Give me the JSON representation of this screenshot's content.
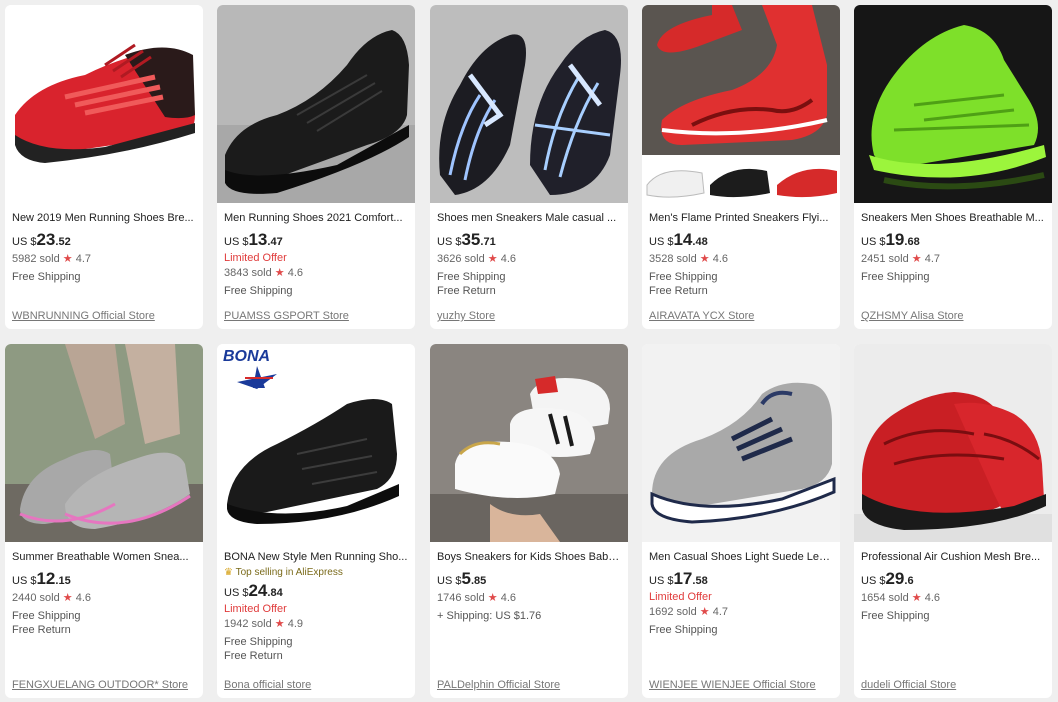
{
  "products": [
    {
      "title": "New 2019 Men Running Shoes Bre...",
      "currency": "US $",
      "price_main": "23",
      "price_cents": ".52",
      "limited": "",
      "top_selling": "",
      "sold": "5982 sold",
      "rating": "4.7",
      "shipping": "Free Shipping",
      "shipping2": "",
      "store": "WBNRUNNING Official Store",
      "image": "red-black running sneaker"
    },
    {
      "title": "Men Running Shoes 2021 Comfort...",
      "currency": "US $",
      "price_main": "13",
      "price_cents": ".47",
      "limited": "Limited Offer",
      "top_selling": "",
      "sold": "3843 sold",
      "rating": "4.6",
      "shipping": "Free Shipping",
      "shipping2": "",
      "store": "PUAMSS GSPORT Store",
      "image": "black knit sneaker"
    },
    {
      "title": "Shoes men Sneakers Male casual ...",
      "currency": "US $",
      "price_main": "35",
      "price_cents": ".71",
      "limited": "",
      "top_selling": "",
      "sold": "3626 sold",
      "rating": "4.6",
      "shipping": "Free Shipping",
      "shipping2": "Free Return",
      "store": "yuzhy Store",
      "image": "black silver blade sneakers"
    },
    {
      "title": "Men's Flame Printed Sneakers Flyi...",
      "currency": "US $",
      "price_main": "14",
      "price_cents": ".48",
      "limited": "",
      "top_selling": "",
      "sold": "3528 sold",
      "rating": "4.6",
      "shipping": "Free Shipping",
      "shipping2": "Free Return",
      "store": "AIRAVATA YCX Store",
      "image": "red flame sneakers"
    },
    {
      "title": "Sneakers Men Shoes Breathable M...",
      "currency": "US $",
      "price_main": "19",
      "price_cents": ".68",
      "limited": "",
      "top_selling": "",
      "sold": "2451 sold",
      "rating": "4.7",
      "shipping": "Free Shipping",
      "shipping2": "",
      "store": "QZHSMY Alisa Store",
      "image": "neon green sneaker"
    },
    {
      "title": "Summer Breathable Women Snea...",
      "currency": "US $",
      "price_main": "12",
      "price_cents": ".15",
      "limited": "",
      "top_selling": "",
      "sold": "2440 sold",
      "rating": "4.6",
      "shipping": "Free Shipping",
      "shipping2": "Free Return",
      "store": "FENGXUELANG OUTDOOR* Store",
      "image": "grey women mesh shoes"
    },
    {
      "title": "BONA New Style Men Running Sho...",
      "currency": "US $",
      "price_main": "24",
      "price_cents": ".84",
      "limited": "Limited Offer",
      "top_selling": "Top selling in AliExpress",
      "sold": "1942 sold",
      "rating": "4.9",
      "shipping": "Free Shipping",
      "shipping2": "Free Return",
      "store": "Bona official store",
      "image": "black leather sneaker with BONA logo",
      "logo_text": "BONA"
    },
    {
      "title": "Boys Sneakers for Kids Shoes Baby...",
      "currency": "US $",
      "price_main": "5",
      "price_cents": ".85",
      "limited": "",
      "top_selling": "",
      "sold": "1746 sold",
      "rating": "4.6",
      "shipping": "+ Shipping: US $1.76",
      "shipping2": "",
      "store": "PALDelphin Official Store",
      "image": "white kids velcro sneakers"
    },
    {
      "title": "Men Casual Shoes Light Suede Lea...",
      "currency": "US $",
      "price_main": "17",
      "price_cents": ".58",
      "limited": "Limited Offer",
      "top_selling": "",
      "sold": "1692 sold",
      "rating": "4.7",
      "shipping": "Free Shipping",
      "shipping2": "",
      "store": "WIENJEE WIENJEE Official Store",
      "image": "grey suede sneaker"
    },
    {
      "title": "Professional Air Cushion Mesh Bre...",
      "currency": "US $",
      "price_main": "29",
      "price_cents": ".6",
      "limited": "",
      "top_selling": "",
      "sold": "1654 sold",
      "rating": "4.6",
      "shipping": "Free Shipping",
      "shipping2": "",
      "store": "dudeli Official Store",
      "image": "red air cushion sneakers"
    }
  ],
  "colors": {
    "limited": "#e03b3b",
    "star": "#e04a4a",
    "background": "#efefef"
  }
}
